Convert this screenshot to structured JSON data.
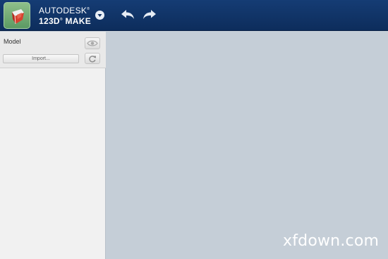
{
  "app": {
    "brand_line1": "AUTODESK",
    "registered_mark": "®",
    "brand_line2_prefix": "123D",
    "brand_line2_suffix": " MAKE",
    "icon": "autodesk-123d-make-logo-icon"
  },
  "toolbar": {
    "menu_icon": "chevron-down-circle-icon",
    "undo_icon": "undo-arrow-icon",
    "redo_icon": "redo-arrow-icon"
  },
  "left_panel": {
    "section_label": "Model",
    "import_label": "Import...",
    "visibility_icon": "eye-icon",
    "refresh_icon": "refresh-icon"
  },
  "watermark": {
    "text": "xfdown.com"
  },
  "colors": {
    "header_bg": "#0f3163",
    "panel_bg": "#f1f1f1",
    "viewport_bg": "#c5ced7",
    "logo_green": "#6fa872",
    "logo_red": "#d23b2b"
  }
}
